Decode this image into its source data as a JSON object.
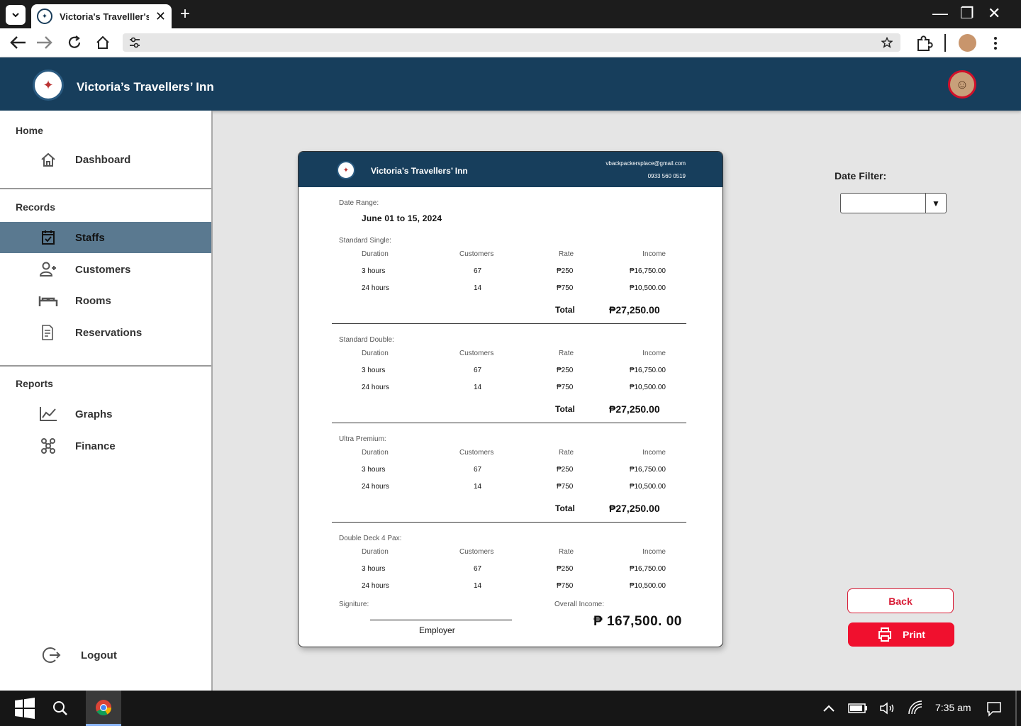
{
  "browser": {
    "tab_title": "Victoria's Travelller's",
    "tab_close": "✕",
    "new_tab": "+",
    "win_min": "—",
    "win_restore": "❐",
    "win_close": "✕"
  },
  "app": {
    "title": "Victoria’s Travellers’ Inn"
  },
  "sidebar": {
    "sections": [
      {
        "label": "Home",
        "items": [
          {
            "label": "Dashboard",
            "icon": "home-icon",
            "active": false
          }
        ]
      },
      {
        "label": "Records",
        "items": [
          {
            "label": "Staffs",
            "icon": "calendar-check-icon",
            "active": true
          },
          {
            "label": "Customers",
            "icon": "user-icon",
            "active": false
          },
          {
            "label": "Rooms",
            "icon": "bed-icon",
            "active": false
          },
          {
            "label": "Reservations",
            "icon": "document-icon",
            "active": false
          }
        ]
      },
      {
        "label": "Reports",
        "items": [
          {
            "label": "Graphs",
            "icon": "chart-icon",
            "active": false
          },
          {
            "label": "Finance",
            "icon": "network-icon",
            "active": false
          }
        ]
      }
    ],
    "logout": "Logout"
  },
  "report": {
    "header_title": "Victoria’s Travellers’ Inn",
    "email": "vbackpackersplace@gmail.com",
    "phone": "0933 560 0519",
    "date_range_label": "Date Range:",
    "date_range_value": "June 01 to 15, 2024",
    "columns": [
      "Duration",
      "Customers",
      "Rate",
      "Income"
    ],
    "total_label": "Total",
    "sections": [
      {
        "name": "Standard Single:",
        "rows": [
          [
            "3 hours",
            "67",
            "₱250",
            "₱16,750.00"
          ],
          [
            "24 hours",
            "14",
            "₱750",
            "₱10,500.00"
          ]
        ],
        "total": "₱27,250.00"
      },
      {
        "name": "Standard Double:",
        "rows": [
          [
            "3 hours",
            "67",
            "₱250",
            "₱16,750.00"
          ],
          [
            "24 hours",
            "14",
            "₱750",
            "₱10,500.00"
          ]
        ],
        "total": "₱27,250.00"
      },
      {
        "name": "Ultra Premium:",
        "rows": [
          [
            "3 hours",
            "67",
            "₱250",
            "₱16,750.00"
          ],
          [
            "24 hours",
            "14",
            "₱750",
            "₱10,500.00"
          ]
        ],
        "total": "₱27,250.00"
      },
      {
        "name": "Double Deck 4 Pax:",
        "rows": [
          [
            "3 hours",
            "67",
            "₱250",
            "₱16,750.00"
          ],
          [
            "24 hours",
            "14",
            "₱750",
            "₱10,500.00"
          ]
        ],
        "total": ""
      }
    ],
    "signature_label": "Signiture:",
    "signature_role": "Employer",
    "overall_label": "Overall Income:",
    "overall_value": "₱  167,500. 00"
  },
  "right_panel": {
    "date_filter_label": "Date Filter:",
    "date_filter_value": "",
    "back_label": "Back",
    "print_label": "Print"
  },
  "taskbar": {
    "time": "7:35 am"
  },
  "colors": {
    "header": "#173e5c",
    "active_nav": "#5a7990",
    "accent_red": "#f0102e"
  }
}
